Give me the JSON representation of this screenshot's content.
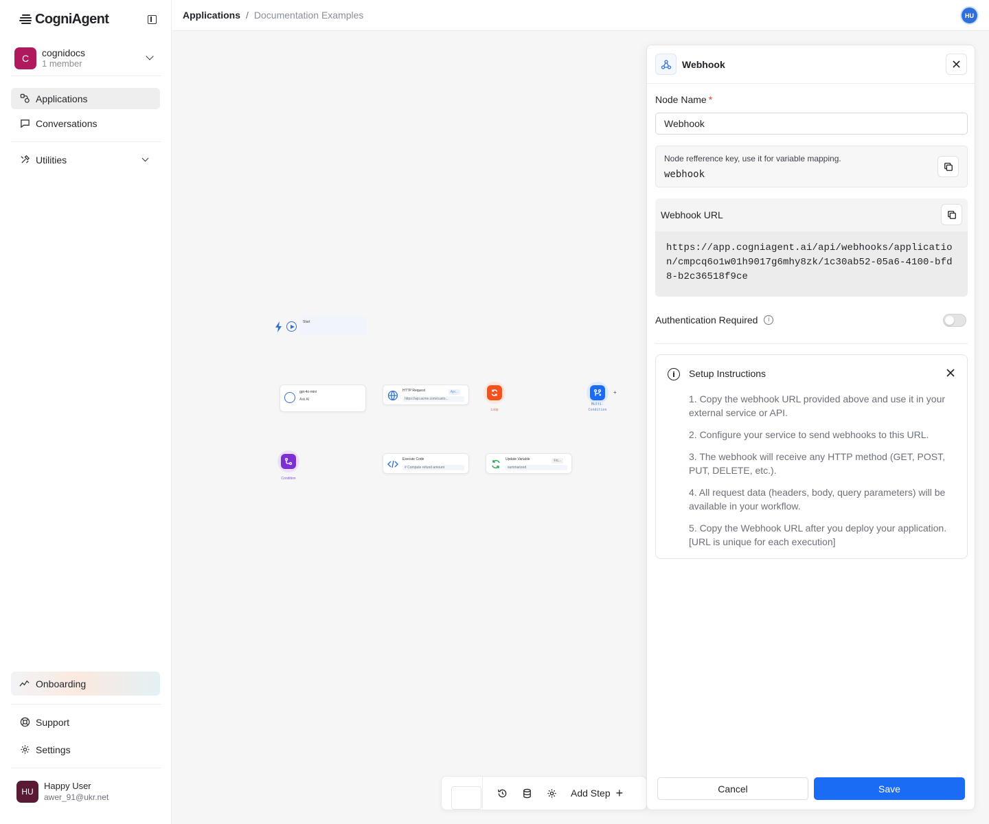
{
  "app": {
    "name": "CogniAgent"
  },
  "org": {
    "initial": "C",
    "name": "cognidocs",
    "members": "1 member"
  },
  "nav": {
    "applications": "Applications",
    "conversations": "Conversations",
    "utilities": "Utilities",
    "onboarding": "Onboarding",
    "support": "Support",
    "settings": "Settings"
  },
  "user": {
    "initials": "HU",
    "name": "Happy User",
    "email": "awer_91@ukr.net"
  },
  "breadcrumb": {
    "root": "Applications",
    "separator": "/",
    "current": "Documentation Examples"
  },
  "header": {
    "avatar": "HU"
  },
  "canvas": {
    "start": {
      "label": "Start"
    },
    "ai_node": {
      "model": "gpt-4o-mini",
      "title": "Ask AI"
    },
    "http_node": {
      "title": "HTTP Request",
      "badge": "Api...",
      "url": "https://api.acme.com/custo..."
    },
    "loop_node": {
      "caption": "Loop"
    },
    "multi_node": {
      "caption": "Multi-Condition"
    },
    "condition_node": {
      "caption": "Condition"
    },
    "code_node": {
      "title": "Execute Code",
      "pill": "# Compute refund amount"
    },
    "var_node": {
      "title": "Update Variable",
      "badge": "t ic...",
      "pill": "summarized"
    },
    "add_step": "Add Step"
  },
  "panel": {
    "title": "Webhook",
    "node_name_label": "Node Name",
    "required_mark": "*",
    "node_name_value": "Webhook",
    "ref_hint": "Node refference key, use it for variable mapping.",
    "ref_key": "webhook",
    "url_label": "Webhook URL",
    "url": "https://app.cogniagent.ai/api/webhooks/application/cmpcq6o1w01h9017g6mhy8zk/1c30ab52-05a6-4100-bfd8-b2c36518f9ce",
    "auth_label": "Authentication Required",
    "auth_enabled": false,
    "setup": {
      "title": "Setup Instructions",
      "steps": [
        "1. Copy the webhook URL provided above and use it in your external service or API.",
        "2. Configure your service to send webhooks to this URL.",
        "3. The webhook will receive any HTTP method (GET, POST, PUT, DELETE, etc.).",
        "4. All request data (headers, body, query parameters) will be available in your workflow.",
        "5. Copy the Webhook URL after you deploy your application. [URL is unique for each execution]"
      ]
    },
    "cancel": "Cancel",
    "save": "Save"
  },
  "colors": {
    "primary": "#1a6cf5",
    "org_avatar": "#b0195e",
    "user_avatar": "#5a1a35",
    "loop": "#f4511e",
    "condition": "#7b2fd4"
  }
}
